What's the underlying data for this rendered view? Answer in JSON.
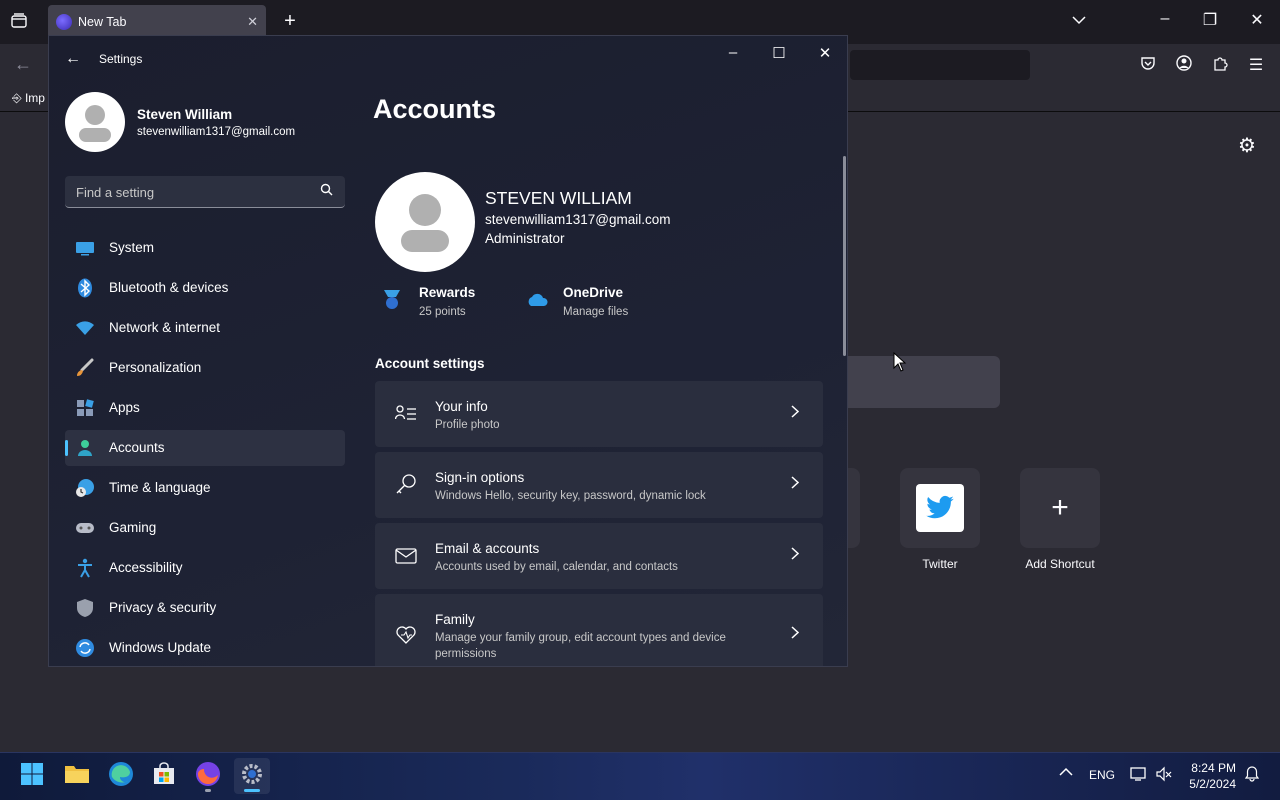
{
  "browser": {
    "tab_title": "New Tab",
    "bookmark_import_label": "Imp",
    "shortcuts": [
      {
        "label": "Twitter"
      },
      {
        "label": "Add Shortcut"
      }
    ]
  },
  "settings": {
    "app_title": "Settings",
    "profile": {
      "name": "Steven William",
      "email": "stevenwilliam1317@gmail.com"
    },
    "search": {
      "placeholder": "Find a setting"
    },
    "nav": [
      {
        "label": "System",
        "icon": "system-icon"
      },
      {
        "label": "Bluetooth & devices",
        "icon": "bluetooth-icon"
      },
      {
        "label": "Network & internet",
        "icon": "wifi-icon"
      },
      {
        "label": "Personalization",
        "icon": "brush-icon"
      },
      {
        "label": "Apps",
        "icon": "apps-icon"
      },
      {
        "label": "Accounts",
        "icon": "accounts-icon",
        "selected": true
      },
      {
        "label": "Time & language",
        "icon": "clock-globe-icon"
      },
      {
        "label": "Gaming",
        "icon": "gamepad-icon"
      },
      {
        "label": "Accessibility",
        "icon": "accessibility-icon"
      },
      {
        "label": "Privacy & security",
        "icon": "shield-icon"
      },
      {
        "label": "Windows Update",
        "icon": "update-icon"
      }
    ],
    "page_title": "Accounts",
    "account": {
      "name": "STEVEN WILLIAM",
      "email": "stevenwilliam1317@gmail.com",
      "role": "Administrator"
    },
    "features": [
      {
        "title": "Rewards",
        "subtitle": "25 points",
        "icon": "rewards-icon"
      },
      {
        "title": "OneDrive",
        "subtitle": "Manage files",
        "icon": "onedrive-icon"
      }
    ],
    "section_title": "Account settings",
    "cards": [
      {
        "title": "Your info",
        "subtitle": "Profile photo",
        "icon": "your-info-icon"
      },
      {
        "title": "Sign-in options",
        "subtitle": "Windows Hello, security key, password, dynamic lock",
        "icon": "key-icon"
      },
      {
        "title": "Email & accounts",
        "subtitle": "Accounts used by email, calendar, and contacts",
        "icon": "mail-icon"
      },
      {
        "title": "Family",
        "subtitle": "Manage your family group, edit account types and device permissions",
        "icon": "family-heart-icon"
      }
    ]
  },
  "taskbar": {
    "language": "ENG",
    "time": "8:24 PM",
    "date": "5/2/2024",
    "apps": [
      "start-icon",
      "file-explorer-icon",
      "edge-icon",
      "store-icon",
      "firefox-icon",
      "settings-icon"
    ]
  },
  "colors": {
    "accent": "#4cc2ff",
    "settings_bg": "#1d2030",
    "card_bg": "#2a2e3e",
    "browser_bg": "#2b2a33"
  }
}
